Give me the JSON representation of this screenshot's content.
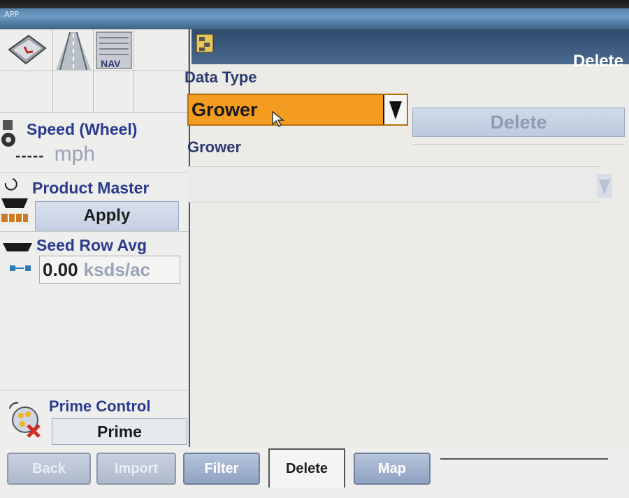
{
  "app_title": "APP",
  "nav_icons": [
    {
      "icon": "compass-card-icon"
    },
    {
      "icon": "road-lanes-icon"
    },
    {
      "icon": "nav-icon",
      "label": "NAV"
    }
  ],
  "speed": {
    "title": "Speed (Wheel)",
    "value": "-----",
    "unit": "mph"
  },
  "product_master": {
    "title": "Product Master",
    "button": "Apply"
  },
  "seed_row": {
    "title": "Seed Row Avg",
    "value": "0.00",
    "unit": "ksds/ac"
  },
  "prime_control": {
    "title": "Prime Control",
    "button": "Prime"
  },
  "header": {
    "title": "Delete"
  },
  "data_type": {
    "label": "Data Type",
    "selected": "Grower"
  },
  "delete_button": "Delete",
  "grower": {
    "label": "Grower",
    "value": ""
  },
  "tabs": [
    {
      "label": "Back",
      "state": "disabled"
    },
    {
      "label": "Import",
      "state": "disabled"
    },
    {
      "label": "Filter",
      "state": "normal"
    },
    {
      "label": "Delete",
      "state": "active"
    },
    {
      "label": "Map",
      "state": "normal"
    }
  ],
  "colors": {
    "accent_orange": "#f39c1f",
    "title_blue": "#2b3a8f",
    "header_dark": "#2f4b6b"
  }
}
